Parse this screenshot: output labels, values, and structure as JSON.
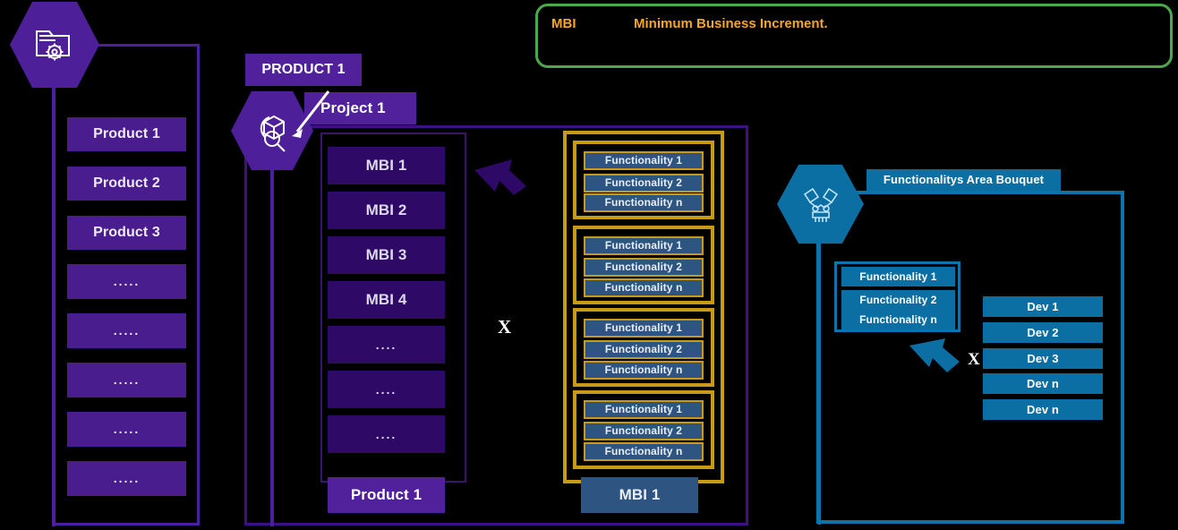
{
  "legend": {
    "abbr": "MBI",
    "expansion": "Minimum Business Increment.",
    "border_color": "#4da84d",
    "text_color": "#f5a623"
  },
  "colors": {
    "purple_tile": "#4a1d8f",
    "purple_deep": "#2e0a66",
    "purple_border": "#4b1fa0",
    "gold": "#c79a18",
    "blue_tile": "#2e5481",
    "teal": "#0b6fa4",
    "background": "#000000"
  },
  "product_column": {
    "icon": "folder-gear-icon",
    "items": [
      "Product 1",
      "Product 2",
      "Product 3",
      ".....",
      ".....",
      ".....",
      ".....",
      "....."
    ]
  },
  "project_section": {
    "product_label": "PRODUCT 1",
    "project_label": "Project 1",
    "icon": "package-search-icon",
    "mbi_items": [
      "MBI 1",
      "MBI 2",
      "MBI 3",
      "MBI 4",
      "....",
      "....",
      "...."
    ],
    "footer_label": "Product 1",
    "multiplier": "X",
    "arrow": "arrow-right-down-icon"
  },
  "functionality_section": {
    "groups": [
      {
        "items": [
          "Functionality 1",
          "Functionality 2",
          "Functionality n"
        ]
      },
      {
        "items": [
          "Functionality 1",
          "Functionality 2",
          "Functionality n"
        ]
      },
      {
        "items": [
          "Functionality 1",
          "Functionality 2",
          "Functionality n"
        ]
      },
      {
        "items": [
          "Functionality 1",
          "Functionality 2",
          "Functionality n"
        ]
      }
    ],
    "footer_label": "MBI 1"
  },
  "bouquet_section": {
    "header_label": "Functionalitys Area Bouquet",
    "icon": "robot-handshake-icon",
    "functionality_items": [
      "Functionality 1",
      "Functionality 2",
      "Functionality n"
    ],
    "multiplier": "X",
    "arrow": "arrow-right-down-icon",
    "dev_items": [
      "Dev 1",
      "Dev 2",
      "Dev 3",
      "Dev n",
      "Dev n"
    ]
  }
}
